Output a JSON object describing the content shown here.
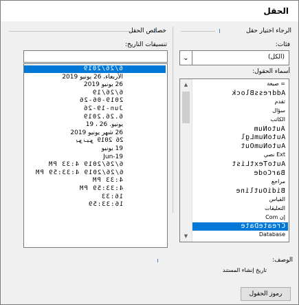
{
  "dialog": {
    "title": "الحقل"
  },
  "left_panel": {
    "heading": "خصائص الحقل",
    "date_formats_label": "تنسيقات التاريخ:"
  },
  "right_panel": {
    "heading": "الرجاء اختيار حقل",
    "categories_label": "فئات:",
    "category_value": "(الكل)",
    "field_names_label": "أسماء الحقول:"
  },
  "date_formats": [
    "6/26/2019",
    "الأربعاء، 26 يونيو 2019",
    "26 يونيو 2019",
    "6/26/19",
    "2019-06-26",
    "Jun-19-26",
    "6.26.2019",
    "يونيو. 26 ، 19",
    "26 شهر يونيو 2019",
    "26 يونيو 2019",
    "19 يونيو",
    "Jun-19",
    "6/26/2019 4:33 PM",
    "6/26/2019 4:33:59 PM",
    "4:33 PM",
    "4:33:59 PM",
    "16:33",
    "16:33:59"
  ],
  "field_names": [
    "= صيغة",
    "AddressBlock",
    "تقدم",
    "سؤال",
    "الكاتب",
    "AutoNum",
    "AutoNumLgl",
    "AutoNumOut",
    "Ext نصي",
    "AutoTextList",
    "BarCode",
    "مراجع",
    "BidiOutline",
    "القياس",
    "التعليقات",
    "إن Com",
    "CreateDate",
    "Database"
  ],
  "description": {
    "label": "الوصف:",
    "text": "تاريخ إنشاء المستند"
  },
  "buttons": {
    "field_codes": "رموز الحقول"
  }
}
